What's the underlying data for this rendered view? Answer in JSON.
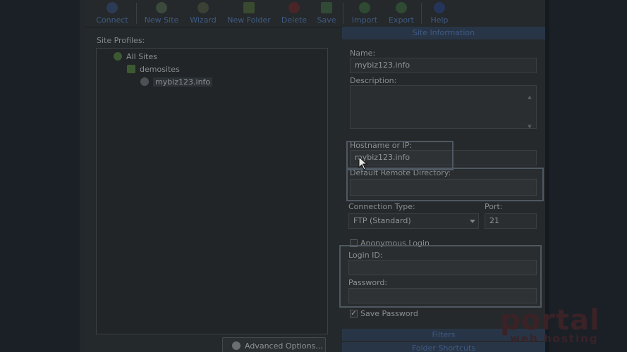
{
  "toolbar": {
    "items": [
      {
        "label": "Connect"
      },
      {
        "label": "New Site"
      },
      {
        "label": "Wizard"
      },
      {
        "label": "New Folder"
      },
      {
        "label": "Delete"
      },
      {
        "label": "Save"
      },
      {
        "label": "Import"
      },
      {
        "label": "Export"
      },
      {
        "label": "Help"
      }
    ]
  },
  "site_profiles": {
    "label": "Site Profiles:",
    "tree": [
      {
        "label": "All Sites",
        "icon": "all-sites-icon"
      },
      {
        "label": "demosites",
        "icon": "folder-icon"
      },
      {
        "label": "mybiz123.info",
        "icon": "site-globe-icon",
        "selected": true
      }
    ],
    "advanced_button": "Advanced Options..."
  },
  "site_info": {
    "header": "Site Information",
    "name_label": "Name:",
    "name_value": "mybiz123.info",
    "description_label": "Description:",
    "description_value": "",
    "hostname_label": "Hostname or IP:",
    "hostname_value": "mybiz123.info",
    "remote_dir_label": "Default Remote Directory:",
    "remote_dir_value": "",
    "connection_type_label": "Connection Type:",
    "connection_type_value": "FTP (Standard)",
    "port_label": "Port:",
    "port_value": "21",
    "anonymous_label": "Anonymous Login",
    "anonymous_checked": false,
    "login_label": "Login ID:",
    "login_value": "",
    "password_label": "Password:",
    "password_value": "",
    "save_password_label": "Save Password",
    "save_password_checked": true,
    "filters_label": "Filters",
    "folder_shortcuts_label": "Folder Shortcuts"
  },
  "watermark": {
    "brand": "portal",
    "tagline": "web hosting"
  },
  "colors": {
    "accent_blue": "#3f5a83",
    "watermark_red": "#3a2226",
    "highlight_border": "#4e5862"
  }
}
